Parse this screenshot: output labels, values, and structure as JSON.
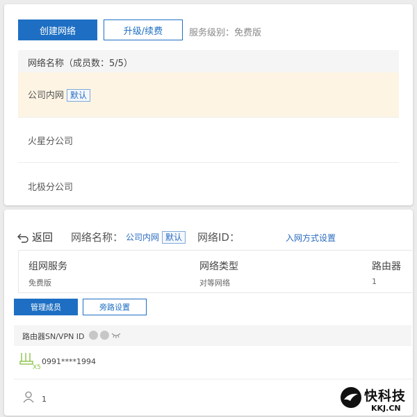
{
  "top_panel": {
    "create_network_button": "创建网络",
    "upgrade_button": "升级/续费",
    "service_level": "服务级别：免费版",
    "list_header": "网络名称（成员数：5/5）",
    "networks": [
      {
        "name": "公司内网",
        "badge": "默认"
      },
      {
        "name": "火星分公司"
      },
      {
        "name": "北极分公司"
      }
    ]
  },
  "bottom_panel": {
    "back_label": "返回",
    "network_name_label": "网络名称：",
    "network_name_value": "公司内网",
    "network_name_badge": "默认",
    "network_id_label": "网络ID：",
    "join_settings_link": "入网方式设置",
    "info": {
      "service_title": "组网服务",
      "service_value": "免费版",
      "type_title": "网络类型",
      "type_value": "对等网络",
      "router_title": "路由器",
      "router_value": "1"
    },
    "tabs": {
      "manage_members": "管理成员",
      "bypass_settings": "旁路设置"
    },
    "member_header": "路由器SN/VPN ID",
    "router_row": {
      "id": "0991****1994",
      "icon_caption": "X5"
    },
    "member_row": {
      "count": "1"
    }
  },
  "watermark": {
    "title": "快科技",
    "subtitle": "KKJ.CN"
  },
  "colors": {
    "primary": "#1e6fc3",
    "highlight_row": "#fdf4e3",
    "link": "#2a6bc1"
  }
}
